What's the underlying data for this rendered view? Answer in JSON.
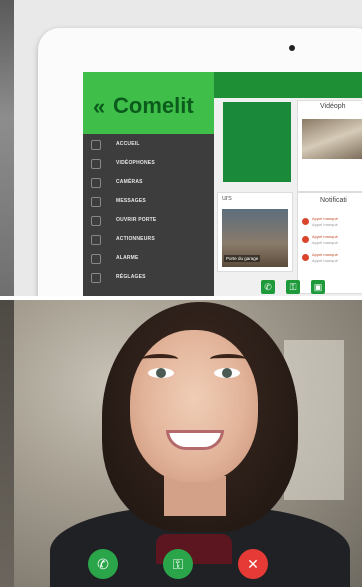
{
  "brand": {
    "name": "Comelit",
    "mark": "«"
  },
  "menu": {
    "items": [
      {
        "label": "ACCUEIL"
      },
      {
        "label": "VIDÉOPHONES"
      },
      {
        "label": "CAMÉRAS"
      },
      {
        "label": "MESSAGES"
      },
      {
        "label": "OUVRIR PORTE"
      },
      {
        "label": "ACTIONNEURS"
      },
      {
        "label": "ALARME"
      },
      {
        "label": "RÉGLAGES"
      }
    ]
  },
  "panels": {
    "video_title": "Vidéoph",
    "notif_title": "Notificati",
    "cam_title": "urs",
    "cam_label": "Porte du garage"
  },
  "notifications": [
    {
      "title": "Appel manqué",
      "sub": "Appel manqué"
    },
    {
      "title": "Appel manqué",
      "sub": "Appel manqué"
    },
    {
      "title": "Appel manqué",
      "sub": "Appel manqué"
    }
  ],
  "icons": {
    "call": "phone-icon",
    "key": "key-icon",
    "hangup": "close-icon"
  },
  "colors": {
    "brand_green": "#3fbf4a",
    "answer_green": "#2aa54a",
    "hangup_red": "#e53a35"
  }
}
